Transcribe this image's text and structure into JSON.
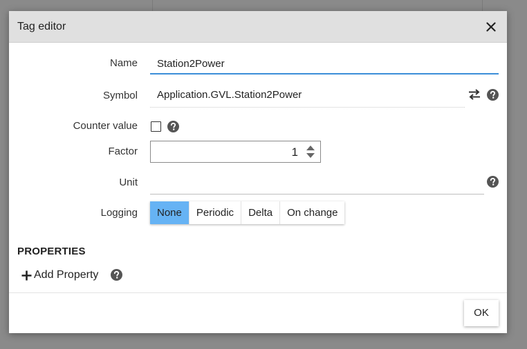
{
  "dialog": {
    "title": "Tag editor",
    "close_icon": "close-icon"
  },
  "form": {
    "name": {
      "label": "Name",
      "value": "Station2Power"
    },
    "symbol": {
      "label": "Symbol",
      "value": "Application.GVL.Station2Power",
      "swap_icon": "swap-arrows-icon"
    },
    "counter_value": {
      "label": "Counter value",
      "checked": false
    },
    "factor": {
      "label": "Factor",
      "value": "1"
    },
    "unit": {
      "label": "Unit",
      "value": ""
    },
    "logging": {
      "label": "Logging",
      "options": [
        "None",
        "Periodic",
        "Delta",
        "On change"
      ],
      "selected": "None"
    }
  },
  "properties": {
    "title": "PROPERTIES",
    "add_label": "Add Property"
  },
  "footer": {
    "ok_label": "OK"
  },
  "colors": {
    "accent": "#3b8ed8",
    "selected_segment": "#66b3f4",
    "header_bg": "#e0e0e0",
    "overlay": "#8a8a8a"
  }
}
